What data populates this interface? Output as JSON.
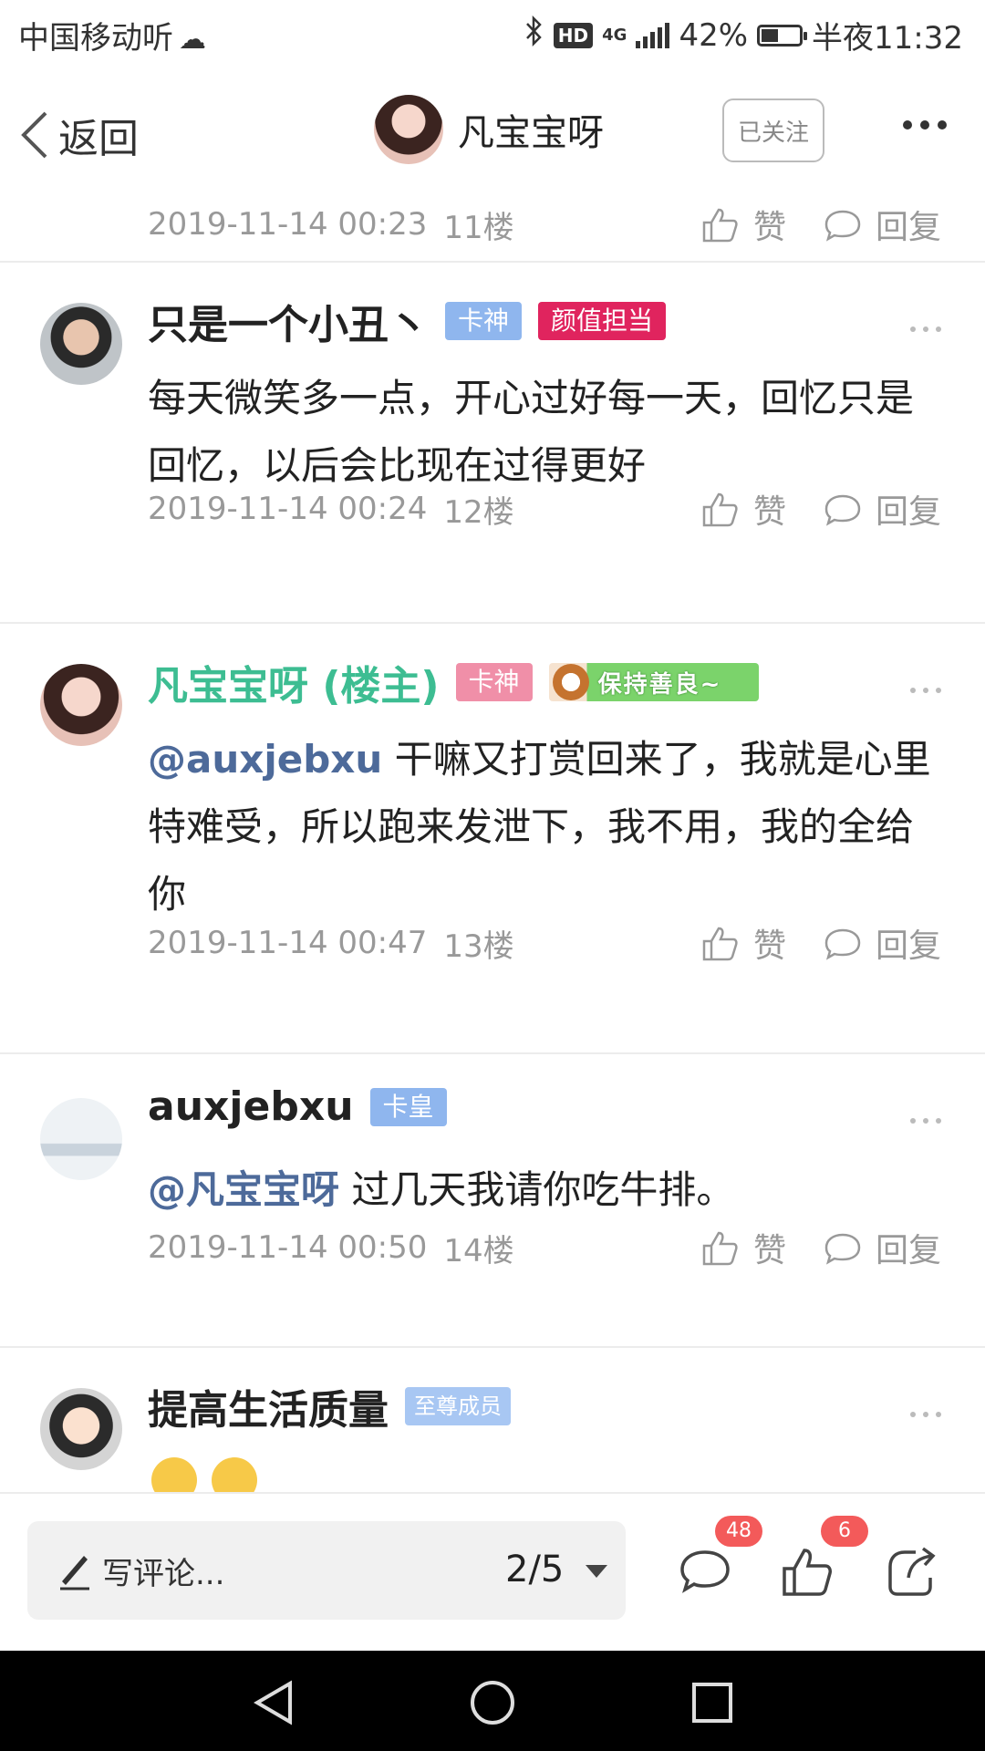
{
  "status_bar": {
    "carrier": "中国移动听",
    "network": "4G",
    "hd": "HD",
    "battery_pct": "42%",
    "battery_level": 0.42,
    "time": "半夜11:32"
  },
  "header": {
    "back_label": "返回",
    "title": "凡宝宝呀",
    "follow_label": "已关注"
  },
  "partial_comment": {
    "time": "2019-11-14 00:23",
    "floor": "11楼",
    "like_label": "赞",
    "reply_label": "回复"
  },
  "comments": [
    {
      "name": "只是一个小丑丶",
      "badges": [
        "卡神",
        "颜值担当"
      ],
      "text": "每天微笑多一点，开心过好每一天，回忆只是回忆，以后会比现在过得更好",
      "time": "2019-11-14 00:24",
      "floor": "12楼",
      "like_label": "赞",
      "reply_label": "回复"
    },
    {
      "name": "凡宝宝呀 (楼主)",
      "badges": [
        "卡神"
      ],
      "pic_badge": "保持善良~",
      "mention": "@auxjebxu",
      "text": " 干嘛又打赏回来了，我就是心里特难受，所以跑来发泄下，我不用，我的全给你",
      "time": "2019-11-14 00:47",
      "floor": "13楼",
      "like_label": "赞",
      "reply_label": "回复"
    },
    {
      "name": "auxjebxu",
      "badges": [
        "卡皇"
      ],
      "mention": "@凡宝宝呀",
      "text": " 过几天我请你吃牛排。",
      "time": "2019-11-14 00:50",
      "floor": "14楼",
      "like_label": "赞",
      "reply_label": "回复"
    },
    {
      "name": "提高生活质量",
      "badges": [
        "至尊成员"
      ],
      "text": ""
    }
  ],
  "bottom_bar": {
    "placeholder": "写评论...",
    "page": "2/5",
    "comment_count": "48",
    "like_count": "6"
  },
  "colors": {
    "owner_name": "#3dbd92",
    "mention": "#4d6a9a",
    "badge_blue": "#8fb6ee",
    "badge_red": "#e0245e",
    "badge_pink": "#f08fa8",
    "count_red": "#f35a5a"
  }
}
